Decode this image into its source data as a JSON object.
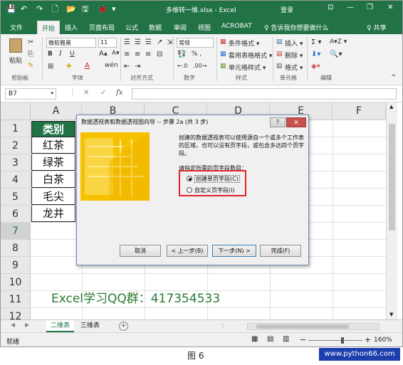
{
  "titlebar": {
    "title": "多维转一维.xlsx - Excel",
    "login": "登录",
    "quick_access": [
      "💾",
      "↶",
      "↷",
      "🗋",
      "📂",
      "🖫",
      "🐞",
      "▾"
    ],
    "ribbon_options": "⊡",
    "minimize": "—",
    "restore": "❐",
    "close": "✕"
  },
  "tabs": [
    "文件",
    "开始",
    "插入",
    "页面布局",
    "公式",
    "数据",
    "审阅",
    "视图",
    "ACROBAT",
    "♀ 告诉我你想要做什么"
  ],
  "share_label": "♀ 共享",
  "ribbon": {
    "paste_label": "粘贴",
    "font_name": "微软雅黑",
    "font_size": "11",
    "bold": "B",
    "italic": "I",
    "underline": "U",
    "number_format": "常规",
    "percent": "% ,",
    "conditional_format": "条件格式 ▾",
    "table_format": "套用表格格式 ▾",
    "cell_style": "单元格样式 ▾",
    "insert": "插入 ▾",
    "delete": "删除 ▾",
    "format": "格式 ▾",
    "sum": "Σ ▾",
    "sort": "A▾Z ▾",
    "groups": [
      "剪贴板",
      "字体",
      "对齐方式",
      "数字",
      "样式",
      "单元格",
      "编辑"
    ]
  },
  "formula_bar": {
    "name_box": "B7",
    "cancel": "✕",
    "enter": "✓",
    "fx": "fx"
  },
  "columns": [
    "A",
    "B",
    "C",
    "D",
    "E",
    "F"
  ],
  "rows": [
    "1",
    "2",
    "3",
    "4",
    "5",
    "6",
    "7",
    "8",
    "9",
    "10",
    "11",
    "12"
  ],
  "cells": {
    "header": "类别",
    "items": [
      "红茶",
      "绿茶",
      "白茶",
      "毛尖",
      "龙井"
    ]
  },
  "qq_text": "Excel学习QQ群：417354533",
  "sheet_tabs": [
    "二维表",
    "三维表"
  ],
  "add_sheet": "+",
  "status": {
    "ready": "就绪",
    "zoom": "160%",
    "zoom_minus": "−",
    "zoom_plus": "+"
  },
  "dialog": {
    "title": "数据透视表和数据透视图向导 -- 步骤 2a (共 3 步)",
    "help": "?",
    "close": "✕",
    "description": "创建的数据透视表可以使用源自一个或多个工作表的区域，也可以没有页字段，或包含多达四个页字段。",
    "question": "请指定所需的页字段数目：",
    "option_single": "创建单页字段(C)",
    "option_custom": "自定义页字段(I)",
    "btn_cancel": "取消",
    "btn_back": "< 上一步(B)",
    "btn_next": "下一步(N) >",
    "btn_finish": "完成(F)"
  },
  "caption": "图 6",
  "watermark": "www.python66.com",
  "colors": {
    "excel_green": "#217346",
    "highlight_red": "#e0242a",
    "qq_green": "#2a7a33",
    "watermark_blue": "#1d3fae"
  }
}
